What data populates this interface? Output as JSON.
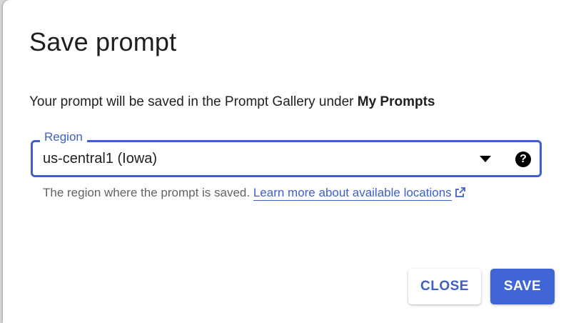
{
  "dialog": {
    "title": "Save prompt",
    "description_prefix": "Your prompt will be saved in the Prompt Gallery under ",
    "description_bold": "My Prompts"
  },
  "region": {
    "label": "Region",
    "value": "us-central1 (Iowa)",
    "hint_text": "The region where the prompt is saved. ",
    "link_text": "Learn more about available locations"
  },
  "buttons": {
    "close": "CLOSE",
    "save": "SAVE"
  },
  "icons": {
    "dropdown": "dropdown-arrow-icon",
    "help": "help-icon",
    "external_link": "external-link-icon"
  },
  "colors": {
    "accent": "#3f5fc9",
    "primary_button": "#3f66d4"
  }
}
